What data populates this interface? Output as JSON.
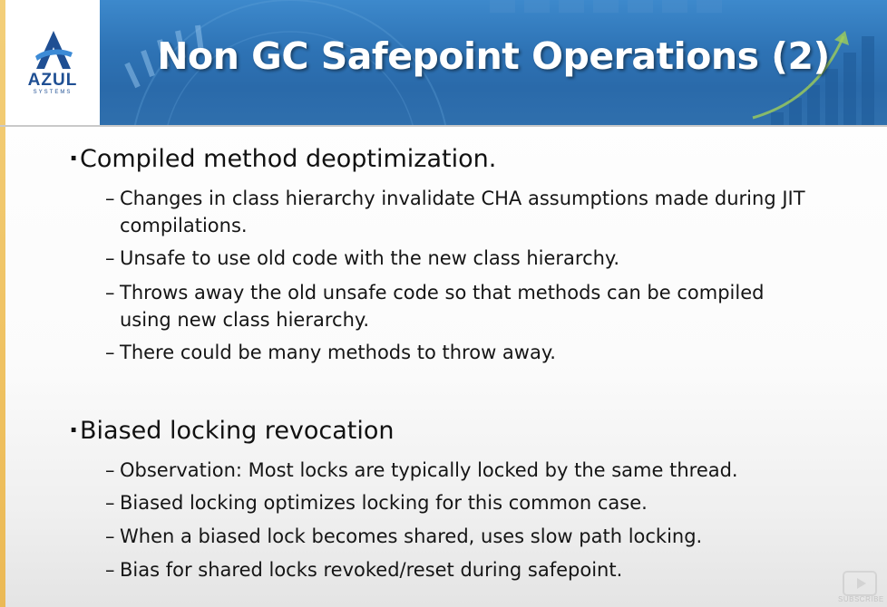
{
  "logo": {
    "name": "AZUL",
    "tagline": "SYSTEMS"
  },
  "slide": {
    "title": "Non GC Safepoint Operations (2)",
    "sections": [
      {
        "heading": "Compiled method deoptimization.",
        "items": [
          {
            "line1": "Changes in class hierarchy invalidate CHA assumptions made during JIT",
            "line2": "compilations."
          },
          {
            "line1": "Unsafe to use old code with the new class hierarchy.",
            "line2": ""
          },
          {
            "line1": "Throws away the old unsafe code so that methods can be compiled",
            "line2": "using new class hierarchy."
          },
          {
            "line1": "There could be many methods to throw away.",
            "line2": ""
          }
        ]
      },
      {
        "heading": "Biased locking revocation",
        "items": [
          {
            "line1": "Observation: Most locks are typically locked by the same thread.",
            "line2": ""
          },
          {
            "line1": "Biased locking optimizes locking for this common case.",
            "line2": ""
          },
          {
            "line1": "When a biased lock becomes shared, uses slow path locking.",
            "line2": ""
          },
          {
            "line1": "Bias for shared locks revoked/reset during safepoint.",
            "line2": ""
          }
        ]
      }
    ]
  },
  "overlay": {
    "subscribe_label": "SUBSCRIBE"
  },
  "colors": {
    "header_blue": "#2e73b5",
    "logo_blue": "#1f4f93",
    "accent_strip": "#efc262",
    "text": "#111111"
  },
  "icons": {
    "logo": "azul-logo-icon",
    "subscribe": "youtube-subscribe-icon"
  }
}
